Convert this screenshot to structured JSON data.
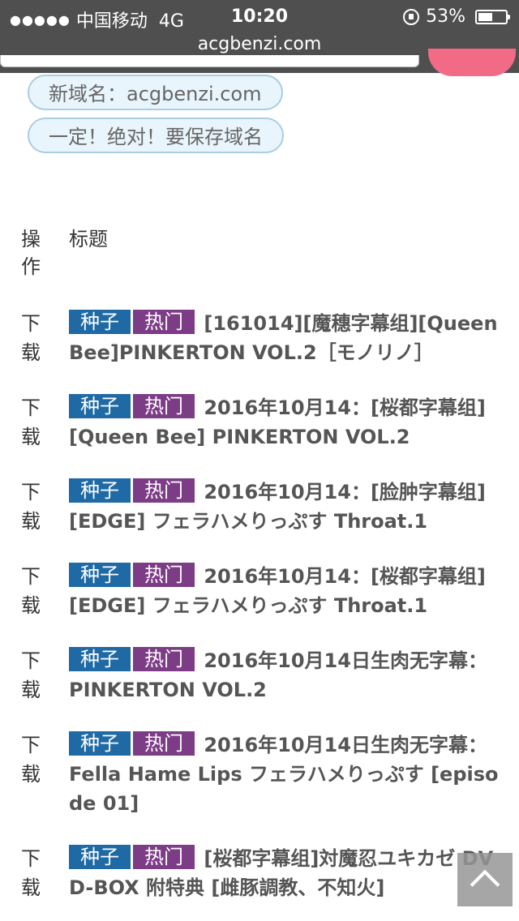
{
  "status_bar": {
    "signal": "●●●●●",
    "carrier": "中国移动",
    "network": "4G",
    "time": "10:20",
    "battery": "53%"
  },
  "browser": {
    "url": "acgbenzi.com"
  },
  "notices": {
    "new_domain": "新域名：acgbenzi.com",
    "save_domain": "一定！绝对！要保存域名"
  },
  "table": {
    "headers": {
      "op": "操作",
      "title": "标题"
    },
    "rows": [
      {
        "op": "下载",
        "seed": "种子",
        "hot": "热门",
        "title": "[161014][魔穗字幕组][Queen Bee]PINKERTON VOL.2［モノリノ］"
      },
      {
        "op": "下载",
        "seed": "种子",
        "hot": "热门",
        "title": "2016年10月14：[桜都字幕组][Queen Bee] PINKERTON VOL.2"
      },
      {
        "op": "下载",
        "seed": "种子",
        "hot": "热门",
        "title": "2016年10月14：[脸肿字幕组][EDGE] フェラハメりっぷす Throat.1"
      },
      {
        "op": "下载",
        "seed": "种子",
        "hot": "热门",
        "title": "2016年10月14：[桜都字幕组][EDGE] フェラハメりっぷす Throat.1"
      },
      {
        "op": "下载",
        "seed": "种子",
        "hot": "热门",
        "title": "2016年10月14日生肉无字幕：PINKERTON VOL.2"
      },
      {
        "op": "下载",
        "seed": "种子",
        "hot": "热门",
        "title": "2016年10月14日生肉无字幕：Fella Hame Lips フェラハメりっぷす [episode 01]"
      },
      {
        "op": "下载",
        "seed": "种子",
        "hot": "热门",
        "title": "[桜都字幕组]対魔忍ユキカゼ DVD-BOX 附特典 [雌豚調教、不知火]"
      }
    ]
  },
  "colors": {
    "seed": "#1f6aa5",
    "hot": "#7c3c86",
    "status_bar": "#4f4f4f",
    "accent": "#f26b86"
  },
  "icons": {
    "back_to_top": "chevron-up-icon"
  }
}
